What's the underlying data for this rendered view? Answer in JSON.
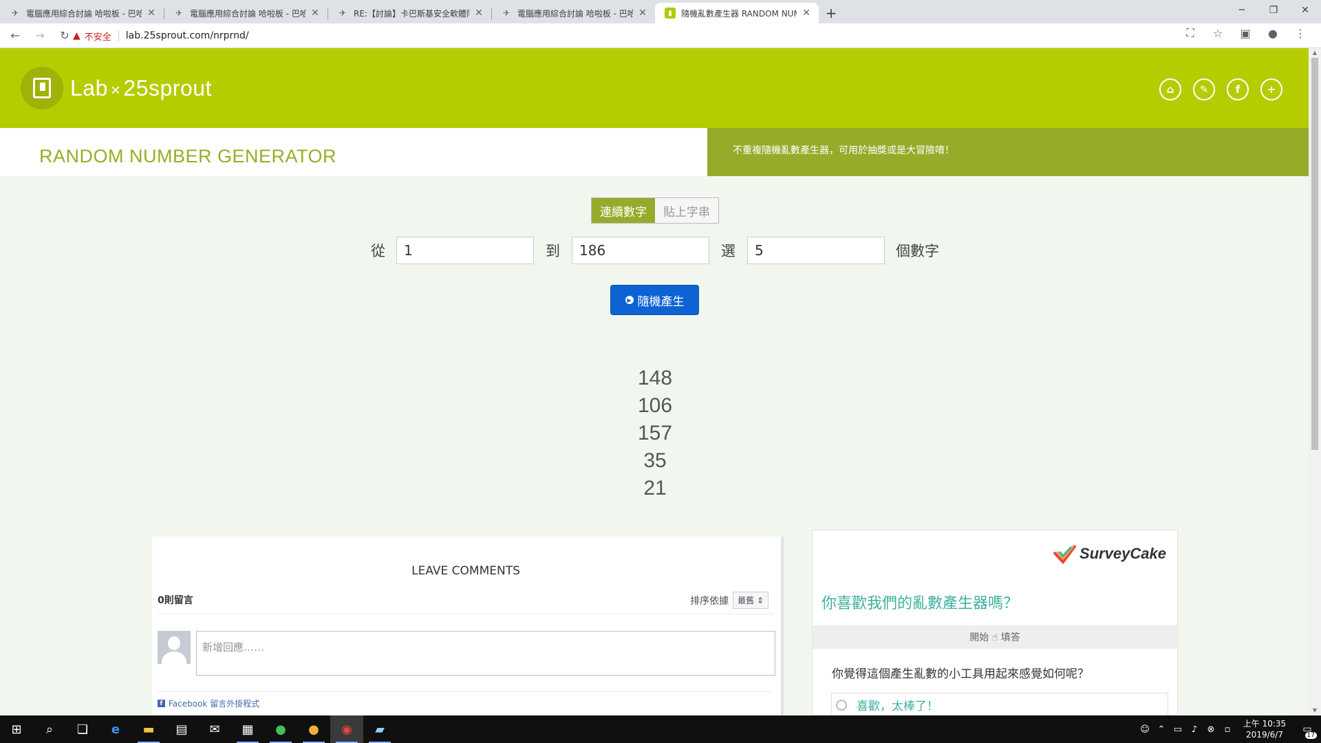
{
  "browser": {
    "tabs": [
      {
        "title": "電腦應用綜合討論 哈啦板 - 巴哈姆特",
        "icon": "bahamut-icon",
        "active": false
      },
      {
        "title": "電腦應用綜合討論 哈啦板 - 巴哈姆特",
        "icon": "bahamut-icon",
        "active": false
      },
      {
        "title": "RE:【討論】卡巴斯基安全軟體限時免費",
        "icon": "bahamut-icon",
        "active": false
      },
      {
        "title": "電腦應用綜合討論 哈啦板 - 巴哈姆特",
        "icon": "bahamut-icon",
        "active": false
      },
      {
        "title": "隨機亂數產生器 RANDOM NUMBER",
        "icon": "sprout-favicon",
        "active": true
      }
    ],
    "insecure_label": "不安全",
    "url": "lab.25sprout.com/nrprnd/"
  },
  "site": {
    "logo_lab": "Lab",
    "logo_cross": "×",
    "logo_brand": "25sprout",
    "header_icons": [
      "home-icon",
      "pen-icon",
      "facebook-icon",
      "plus-icon"
    ],
    "page_title": "RANDOM NUMBER GENERATOR",
    "description": "不重複隨機亂數產生器，可用於抽獎或是大冒險唷！",
    "accent_color": "#b5cc01",
    "dark_accent_color": "#96ab2a"
  },
  "generator": {
    "mode_sequential": "連續數字",
    "mode_paste": "貼上字串",
    "from_label": "從",
    "from_value": "1",
    "to_label": "到",
    "to_value": "186",
    "pick_label": "選",
    "pick_value": "5",
    "unit_label": "個數字",
    "generate_label": "隨機產生",
    "results": [
      "148",
      "106",
      "157",
      "35",
      "21"
    ]
  },
  "comments": {
    "title": "LEAVE COMMENTS",
    "count_label": "0則留言",
    "sort_label": "排序依據",
    "sort_value": "最舊",
    "input_placeholder": "新增回應……",
    "plugin_label": "Facebook 留言外掛程式"
  },
  "survey": {
    "brand": "SurveyCake",
    "question": "你喜歡我們的亂數產生器嗎？",
    "start_label": "開始 ☝ 填答",
    "sub_question": "你覺得這個產生亂數的小工具用起來感覺如何呢？",
    "option_1": "喜歡，太棒了！"
  },
  "taskbar": {
    "clock_time": "上午 10:35",
    "clock_date": "2019/6/7",
    "notification_count": "17"
  }
}
